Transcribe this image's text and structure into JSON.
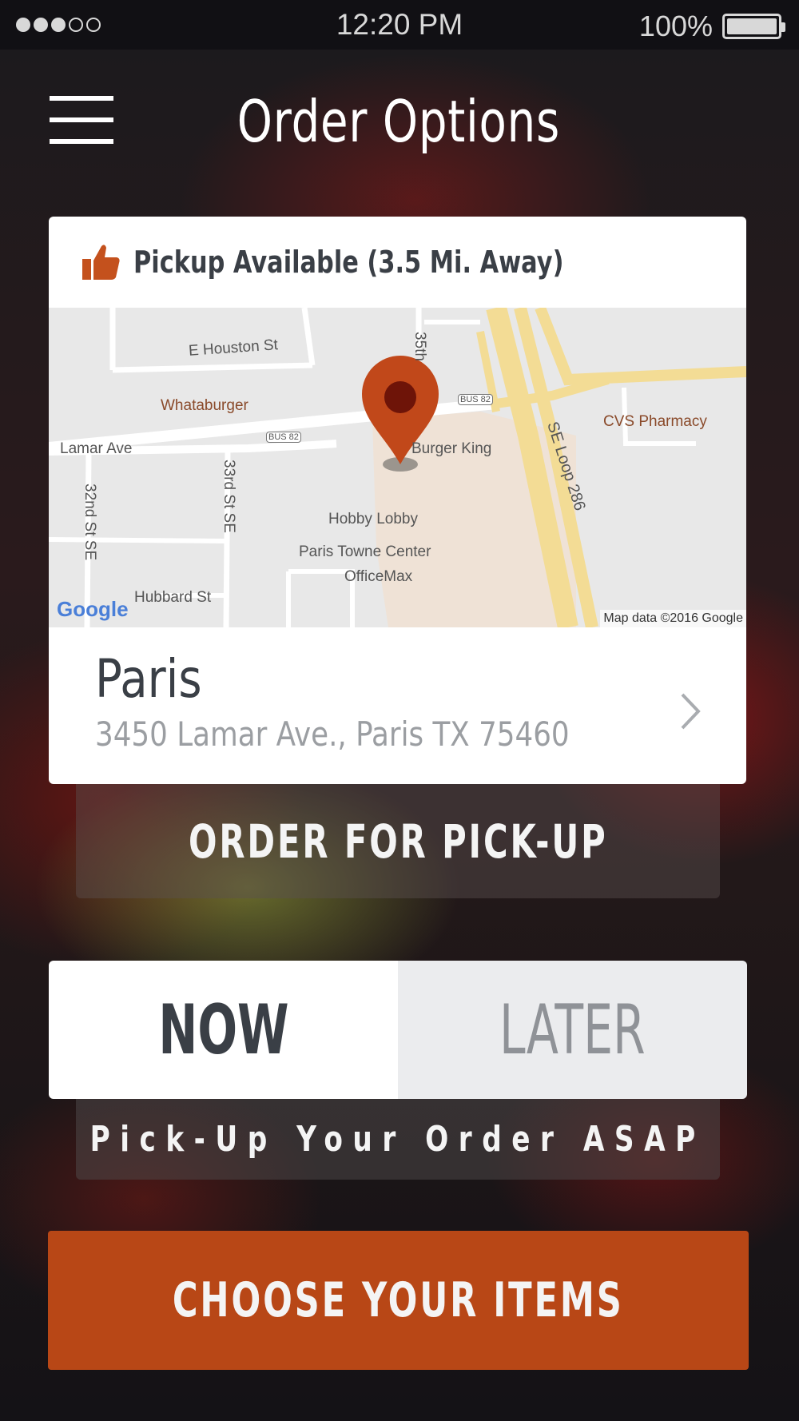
{
  "status_bar": {
    "time": "12:20 PM",
    "battery": "100%",
    "signal_bars_filled": 3,
    "signal_bars_total": 5
  },
  "header": {
    "title": "Order Options",
    "menu_icon": "hamburger-menu-icon"
  },
  "location_card": {
    "availability": "Pickup Available (3.5 Mi. Away)",
    "availability_icon": "thumbs-up-icon",
    "map": {
      "streets": [
        "E Houston St",
        "Lamar Ave",
        "32nd St SE",
        "33rd St SE",
        "Hubbard St",
        "SE Loop 286",
        "35th"
      ],
      "shields": [
        "BUS 82",
        "BUS 82"
      ],
      "pois": [
        "Whataburger",
        "Burger King",
        "CVS Pharmacy",
        "Hobby Lobby",
        "Paris Towne Center",
        "OfficeMax"
      ],
      "logo": "Google",
      "copyright": "Map data ©2016 Google"
    },
    "name": "Paris",
    "address": "3450 Lamar Ave., Paris TX 75460"
  },
  "order_type_button": "ORDER FOR PICK-UP",
  "timing": {
    "options": [
      "NOW",
      "LATER"
    ],
    "selected": "NOW",
    "description": "Pick-Up Your Order ASAP"
  },
  "primary_button": "CHOOSE YOUR ITEMS",
  "colors": {
    "accent": "#b84716",
    "text_dark": "#3a3f46",
    "text_muted": "#9b9ea2"
  }
}
